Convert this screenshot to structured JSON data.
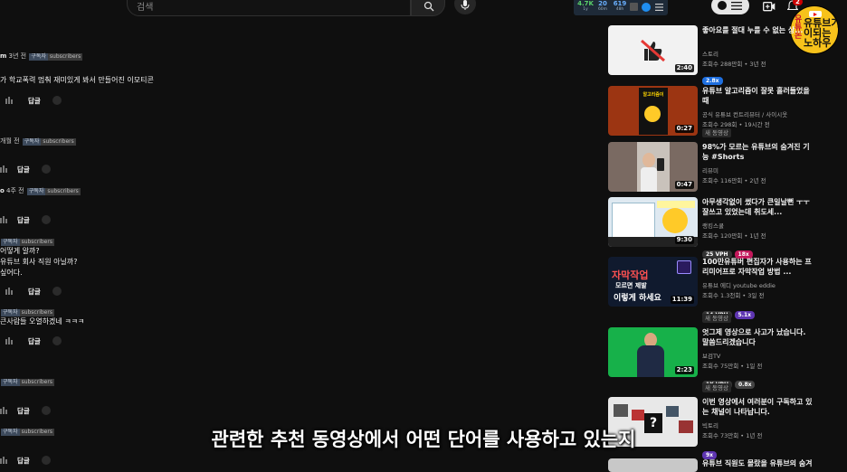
{
  "search": {
    "placeholder": "검색"
  },
  "stats": [
    {
      "value": "4.7K",
      "label": "1y",
      "color": "#5ad06a"
    },
    {
      "value": "20",
      "label": "60m",
      "color": "#6ab0ff"
    },
    {
      "value": "619",
      "label": "48h",
      "color": "#6ab0ff"
    }
  ],
  "notifications": {
    "count": "2"
  },
  "logo": {
    "line1": "유튜브가",
    "line2": "이되는",
    "line3": "노하우",
    "side": "유튜",
    "side2": "돈",
    "brand": "YouTube"
  },
  "comments": [
    {
      "author": "m",
      "time": "3년 전",
      "tag": "구독자",
      "tag2": "subscribers",
      "lines": [
        "가 학교폭력 멈춰 재미있게 봐서 만들어진 이모티콘"
      ],
      "reply": "답글"
    },
    {
      "author": "",
      "time": "개월 전",
      "tag": "구독자",
      "tag2": "subscribers",
      "lines": [],
      "reply": "답글"
    },
    {
      "author": "o",
      "time": "4주 전",
      "tag": "구독자",
      "tag2": "subscribers",
      "lines": [],
      "reply": "답글"
    },
    {
      "author": "",
      "time": "",
      "tag": "구독자",
      "tag2": "subscribers",
      "lines": [
        "어떻게 알까?",
        "유튜브 회사 직원 아닐까?",
        "싶어다."
      ],
      "reply": "답글"
    },
    {
      "author": "",
      "time": "",
      "tag": "구독자",
      "tag2": "subscribers",
      "lines": [
        "큰사람들 오열하겠네 ㅋㅋㅋ"
      ],
      "reply": "답글"
    },
    {
      "author": "",
      "time": "",
      "tag": "구독자",
      "tag2": "subscribers",
      "lines": [],
      "reply": "답글"
    },
    {
      "author": "",
      "time": "",
      "tag": "구독자",
      "tag2": "subscribers",
      "lines": [],
      "reply": "답글"
    }
  ],
  "videos": [
    {
      "title": "좋아요를 절대 누를 수 없는 상...",
      "channel": "스토리",
      "views": "조회수 288만회 • 3년 전",
      "duration": "2:40",
      "badges": [
        {
          "text": "2.8x",
          "color": "#1e6fe0"
        }
      ],
      "tag": ""
    },
    {
      "title": "유튜브 알고리즘이 잘못 흘러들었을때",
      "channel": "공식 유튜브 컨트리뷰터 / 사이시옷",
      "views": "조회수 298회 • 19시간 전",
      "duration": "0:27",
      "badges": [],
      "tag": "새 동영상"
    },
    {
      "title": "98%가 모르는 유튜브의 숨겨진 기능 #Shorts",
      "channel": "리뷰미",
      "views": "조회수 116만회 • 2년 전",
      "duration": "0:47",
      "badges": [],
      "tag": ""
    },
    {
      "title": "아무생각없이 썼다가 큰일날뻔 ㅜㅜ 잘쓰고 있었는데 취도세...",
      "channel": "랭킹스쿨",
      "views": "조회수 120만회 • 1년 전",
      "duration": "9:30",
      "badges": [
        {
          "text": "25 VPH",
          "color": "#333"
        },
        {
          "text": "18x",
          "color": "#c2185b"
        }
      ],
      "tag": ""
    },
    {
      "title": "100만유튜버 편집자가 사용하는 프리미어프로 자막작업 방법 ...",
      "channel": "유튜브 에디 youtube eddie",
      "views": "조회수 1.3천회 • 3일 전",
      "duration": "11:39",
      "badges": [
        {
          "text": "14 VPH",
          "color": "#333"
        },
        {
          "text": "5.1x",
          "color": "#5e35b1"
        }
      ],
      "tag": "새 동영상"
    },
    {
      "title": "엇그제 영상으로 사고가 났습니다. 말씀드리겠습니다",
      "channel": "보검TV",
      "views": "조회수 75만회 • 1일 전",
      "duration": "2:23",
      "badges": [
        {
          "text": "1K VPH",
          "color": "#333"
        },
        {
          "text": "0.8x",
          "color": "#444"
        }
      ],
      "tag": "새 동영상"
    },
    {
      "title": "이번 영상에서 여러분이 구독하고 있는 채널이 나타납니다.",
      "channel": "빅토리",
      "views": "조회수 73만회 • 1년 전",
      "duration": "",
      "badges": [
        {
          "text": "9x",
          "color": "#5e35b1"
        }
      ],
      "tag": ""
    },
    {
      "title": "유튜브 직원도 몰랐을 유튜브의 숨겨진 기능",
      "channel": "",
      "views": "",
      "duration": "",
      "badges": [],
      "tag": ""
    }
  ],
  "thumb_text": {
    "v2": "알고리즘이",
    "v5a": "자막작업",
    "v5b": "모르면 제발",
    "v5c": "이렇게 하세요"
  },
  "subtitle": "관련한 추천 동영상에서 어떤 단어를 사용하고 있는지"
}
